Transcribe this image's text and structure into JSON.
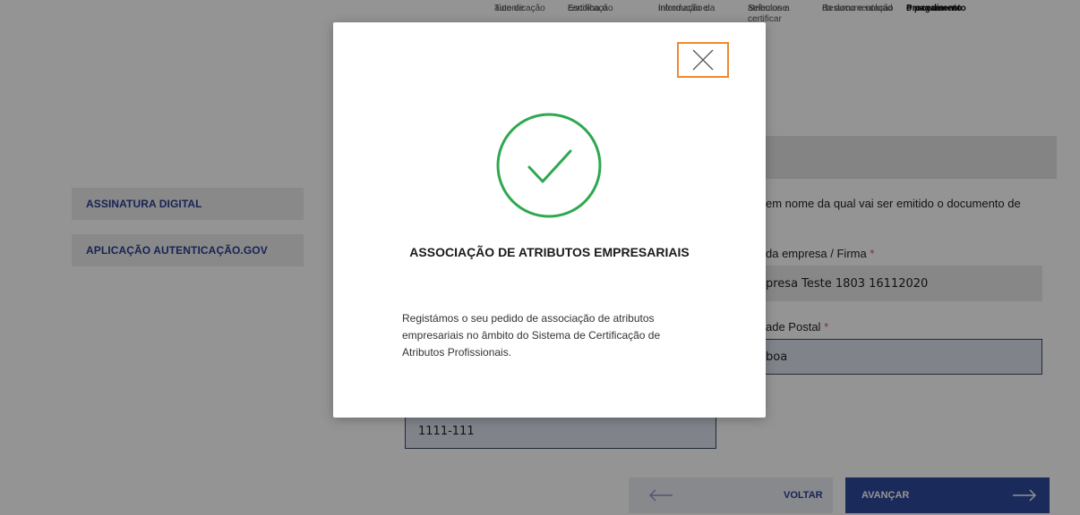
{
  "stepper": {
    "steps": [
      {
        "line1": "Tipo de",
        "line2": "autenticação"
      },
      {
        "line1": "Escolha o tipo de",
        "line2": "certificação"
      },
      {
        "line1": "Introdução e",
        "line2": "informação da"
      },
      {
        "line1": "Selecione os",
        "line2": "atributos a",
        "line3": "certificar"
      },
      {
        "line1": "Resumo e upload",
        "line2": "da documentação"
      },
      {
        "line1": "Procedimento para",
        "line2": "o pagamento"
      }
    ]
  },
  "sidebar": {
    "items": [
      {
        "label": "ASSINATURA DIGITAL"
      },
      {
        "label": "APLICAÇÃO AUTENTICAÇÃO.GOV"
      }
    ]
  },
  "form": {
    "intro_text": "em nome da qual vai ser emitido o documento de",
    "company_label": "da empresa / Firma",
    "company_value": "presa Teste 1803 16112020",
    "locality_label": "ade Postal",
    "locality_value": "boa",
    "postal_code_value": "1111-111",
    "required_mark": "*"
  },
  "navigation": {
    "back_label": "VOLTAR",
    "next_label": "AVANÇAR"
  },
  "modal": {
    "title": "ASSOCIAÇÃO DE ATRIBUTOS EMPRESARIAIS",
    "body": "Registámos o seu pedido de associação de atributos empresariais no âmbito do Sistema de Certificação de Atributos Profissionais.",
    "close_icon": "close-icon",
    "success_icon": "check-circle-icon"
  },
  "colors": {
    "accent_blue": "#2e4a9e",
    "success_green": "#2ea84f",
    "focus_orange": "#f0882e"
  }
}
